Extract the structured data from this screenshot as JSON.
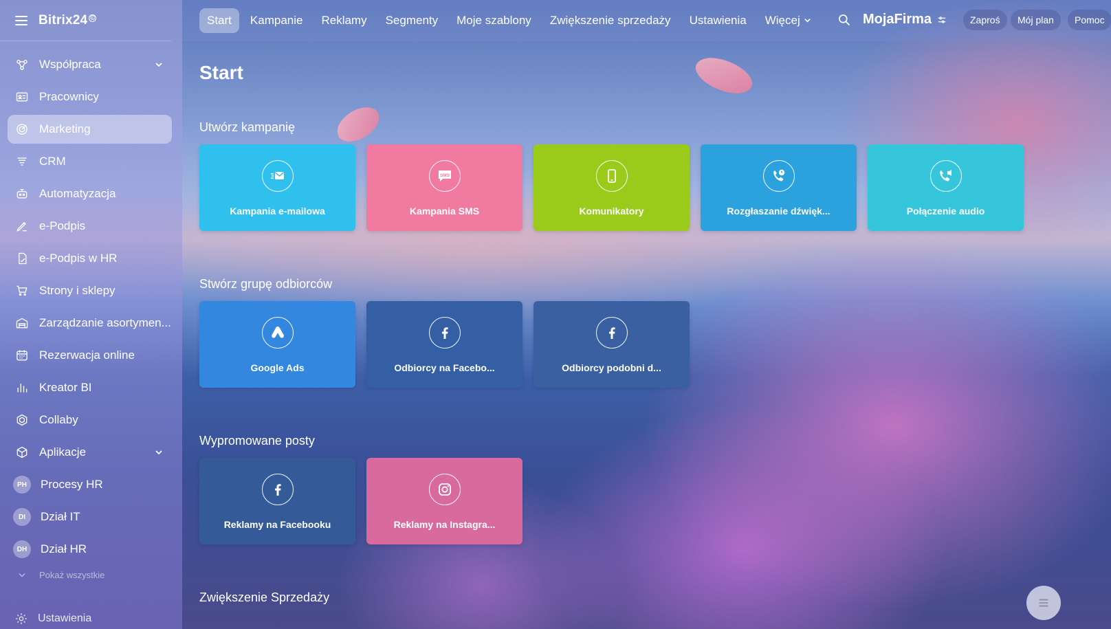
{
  "app": {
    "logo": "Bitrix24",
    "logo_mark": "©"
  },
  "sidebar": {
    "items": [
      {
        "label": "Współpraca",
        "icon": "collaboration-icon",
        "expandable": true
      },
      {
        "label": "Pracownicy",
        "icon": "employees-icon"
      },
      {
        "label": "Marketing",
        "icon": "marketing-icon",
        "active": true
      },
      {
        "label": "CRM",
        "icon": "crm-icon"
      },
      {
        "label": "Automatyzacja",
        "icon": "automation-icon"
      },
      {
        "label": "e-Podpis",
        "icon": "signature-icon"
      },
      {
        "label": "e-Podpis w HR",
        "icon": "hr-signature-icon"
      },
      {
        "label": "Strony i sklepy",
        "icon": "cart-icon"
      },
      {
        "label": "Zarządzanie asortymen...",
        "icon": "inventory-icon"
      },
      {
        "label": "Rezerwacja online",
        "icon": "calendar-icon"
      },
      {
        "label": "Kreator BI",
        "icon": "bar-chart-icon"
      },
      {
        "label": "Collaby",
        "icon": "collaby-icon"
      },
      {
        "label": "Aplikacje",
        "icon": "apps-icon",
        "expandable": true
      },
      {
        "label": "Procesy HR",
        "avatar": "PH"
      },
      {
        "label": "Dział IT",
        "avatar": "DI"
      },
      {
        "label": "Dział HR",
        "avatar": "DH"
      }
    ],
    "collapse_label": "Pokaż wszystkie",
    "settings_label": "Ustawienia"
  },
  "topbar": {
    "tabs": [
      "Start",
      "Kampanie",
      "Reklamy",
      "Segmenty",
      "Moje szablony",
      "Zwiększenie sprzedaży",
      "Ustawienia",
      "Więcej"
    ],
    "active_tab": "Start",
    "company": "MojaFirma",
    "invite": "Zaproś",
    "plan": "Mój plan",
    "help": "Pomoc"
  },
  "main": {
    "title": "Start",
    "sections": [
      {
        "title": "Utwórz kampanię",
        "tiles": [
          {
            "label": "Kampania e-mailowa",
            "color": "#2fc0ee",
            "icon": "email-icon"
          },
          {
            "label": "Kampania SMS",
            "color": "#f17aa1",
            "icon": "sms-icon"
          },
          {
            "label": "Komunikatory",
            "color": "#9acb1a",
            "icon": "phone-icon"
          },
          {
            "label": "Rozgłaszanie dźwięk...",
            "color": "#2ba2dd",
            "icon": "voice-broadcast-icon"
          },
          {
            "label": "Połączenie audio",
            "color": "#36c6dc",
            "icon": "audio-call-icon"
          }
        ]
      },
      {
        "title": "Stwórz grupę odbiorców",
        "tiles": [
          {
            "label": "Google Ads",
            "color": "#3387de",
            "icon": "google-ads-icon"
          },
          {
            "label": "Odbiorcy na Facebo...",
            "color": "#345fa4",
            "icon": "facebook-icon"
          },
          {
            "label": "Odbiorcy podobni d...",
            "color": "#3a60a2",
            "icon": "facebook-icon"
          }
        ]
      },
      {
        "title": "Wypromowane posty",
        "tiles": [
          {
            "label": "Reklamy na Facebooku",
            "color": "#345a98",
            "icon": "facebook-icon"
          },
          {
            "label": "Reklamy na Instagra...",
            "color": "#d86a9e",
            "icon": "instagram-icon"
          }
        ]
      },
      {
        "title": "Zwiększenie Sprzedaży",
        "tiles": []
      }
    ]
  }
}
